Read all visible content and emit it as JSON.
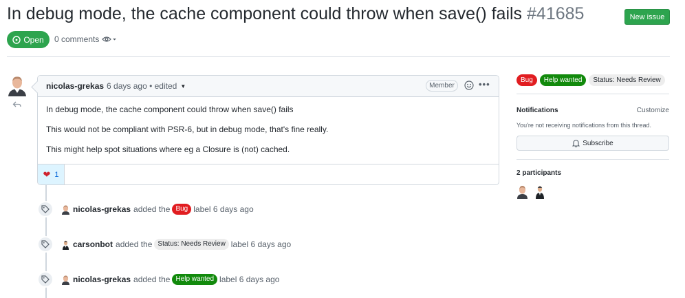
{
  "issue": {
    "title": "In debug mode, the cache component could throw when save() fails",
    "number": "#41685",
    "new_issue_label": "New issue",
    "state": "Open",
    "comments_count": "0 comments"
  },
  "comment": {
    "author": "nicolas-grekas",
    "meta": "6 days ago • edited",
    "role_badge": "Member",
    "paragraphs": [
      "In debug mode, the cache component could throw when save() fails",
      "This would not be compliant with PSR-6, but in debug mode, that's fine really.",
      "This might help spot situations where eg a Closure is (not) cached."
    ],
    "reaction_count": "1"
  },
  "events": [
    {
      "actor": "nicolas-grekas",
      "action": "added the",
      "label": "Bug",
      "suffix": "label 6 days ago"
    },
    {
      "actor": "carsonbot",
      "action": "added the",
      "label": "Status: Needs Review",
      "suffix": "label 6 days ago"
    },
    {
      "actor": "nicolas-grekas",
      "action": "added the",
      "label": "Help wanted",
      "suffix": "label 6 days ago"
    }
  ],
  "sidebar": {
    "labels": [
      "Bug",
      "Help wanted",
      "Status: Needs Review"
    ],
    "notifications_heading": "Notifications",
    "customize_label": "Customize",
    "notifications_text": "You're not receiving notifications from this thread.",
    "subscribe_label": "Subscribe",
    "participants_heading": "2 participants"
  },
  "colors": {
    "open_green": "#2da44e",
    "bug_red": "#e11d21",
    "help_green": "#128a0c",
    "status_gray": "#ededed"
  },
  "icons": {
    "state": "issue-opened-icon",
    "watch": "eye-icon",
    "reply": "reply-icon",
    "emoji": "smiley-icon",
    "more": "kebab-horizontal-icon",
    "reaction": "heart-icon",
    "event": "tag-icon",
    "subscribe": "bell-icon"
  }
}
